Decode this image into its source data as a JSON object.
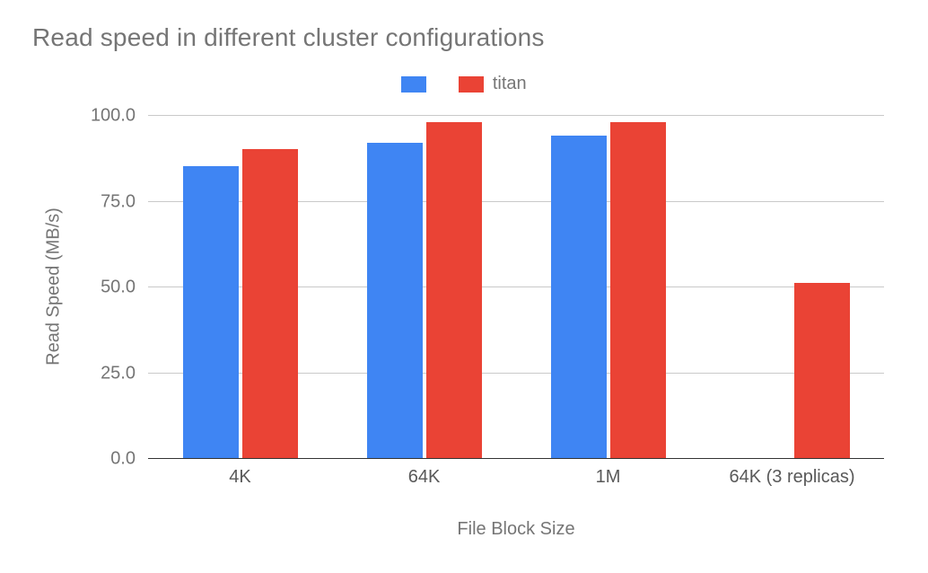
{
  "chart_data": {
    "type": "bar",
    "title": "Read speed in different cluster configurations",
    "xlabel": "File Block Size",
    "ylabel": "Read Speed (MB/s)",
    "ylim": [
      0,
      100
    ],
    "y_ticks": [
      "0.0",
      "25.0",
      "50.0",
      "75.0",
      "100.0"
    ],
    "categories": [
      "4K",
      "64K",
      "1M",
      "64K (3 replicas)"
    ],
    "series": [
      {
        "name": "",
        "color": "#3f85f3",
        "values": [
          85,
          92,
          94,
          null
        ]
      },
      {
        "name": "titan",
        "color": "#ea4335",
        "values": [
          90,
          98,
          98,
          51
        ]
      }
    ]
  }
}
